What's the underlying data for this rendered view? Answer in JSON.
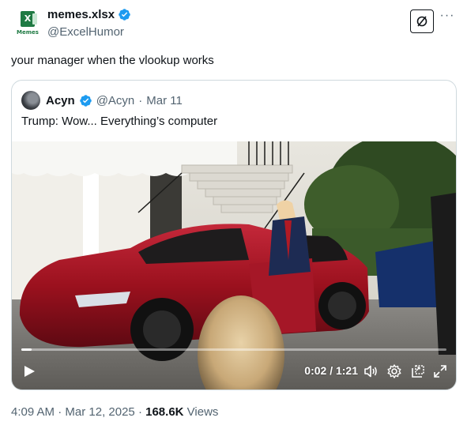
{
  "tweet": {
    "avatar_label": "Memes",
    "avatar_glyph": "X",
    "display_name": "memes.xlsx",
    "handle": "@ExcelHumor",
    "text": "your manager when the vlookup works",
    "more_label": "···"
  },
  "quote": {
    "display_name": "Acyn",
    "handle": "@Acyn",
    "separator": "·",
    "date": "Mar 11",
    "text": "Trump: Wow... Everything’s computer"
  },
  "video": {
    "time": "0:02 / 1:21",
    "progress": 0.025
  },
  "meta": {
    "time": "4:09 AM",
    "dot1": "·",
    "date": "Mar 12, 2025",
    "dot2": "·",
    "views_count": "168.6K",
    "views_label": "Views"
  },
  "colors": {
    "verified": "#1d9bf0",
    "excel_green": "#1f7a43",
    "car_red": "#9b111e"
  }
}
